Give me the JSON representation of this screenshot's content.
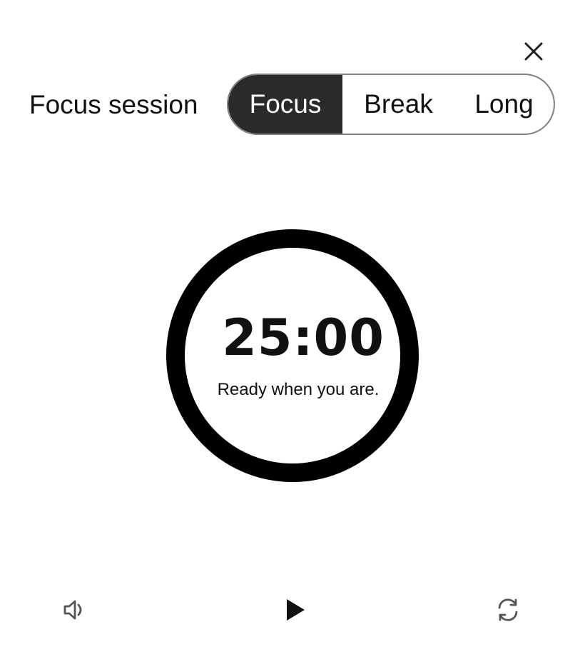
{
  "header": {
    "title": "Focus session"
  },
  "modes": {
    "items": [
      {
        "label": "Focus",
        "active": true
      },
      {
        "label": "Break",
        "active": false
      },
      {
        "label": "Long",
        "active": false
      }
    ]
  },
  "timer": {
    "time": "25:00",
    "status": "Ready when you are."
  },
  "icons": {
    "close": "close-icon",
    "volume": "volume-icon",
    "play": "play-icon",
    "reset": "refresh-icon"
  },
  "colors": {
    "active_segment": "#2a2a2a",
    "ring": "#000000",
    "segment_border": "#808080",
    "icon_gray": "#555555"
  }
}
